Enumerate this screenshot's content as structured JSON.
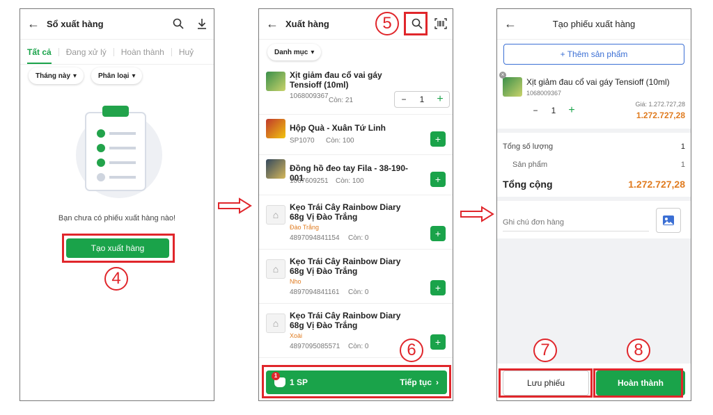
{
  "screen1": {
    "title": "Sổ xuất hàng",
    "tabs": [
      "Tất cả",
      "Đang xử lý",
      "Hoàn thành",
      "Huỷ"
    ],
    "filters": [
      "Tháng này",
      "Phân loại"
    ],
    "empty_text": "Bạn chưa có phiếu xuất hàng nào!",
    "create_button": "Tạo xuất hàng",
    "step": "4"
  },
  "screen2": {
    "title": "Xuất hàng",
    "category_filter": "Danh mục",
    "step_search": "5",
    "step_continue": "6",
    "products": [
      {
        "name": "Xịt giảm đau cổ vai gáy Tensioff (10ml)",
        "code": "1068009367",
        "stock": "Còn: 21",
        "qty": "1"
      },
      {
        "name": "Hộp Quà - Xuân Tứ Linh",
        "code": "SP1070",
        "stock": "Còn: 100"
      },
      {
        "name": "Đồng hồ đeo tay Fila - 38-190-001",
        "code": "1067609251",
        "stock": "Còn: 100"
      },
      {
        "name": "Kẹo Trái Cây Rainbow Diary 68g Vị Đào Trắng",
        "variant": "Đào Trắng",
        "code": "4897094841154",
        "stock": "Còn: 0"
      },
      {
        "name": "Kẹo Trái Cây Rainbow Diary 68g Vị Đào Trắng",
        "variant": "Nho",
        "code": "4897094841161",
        "stock": "Còn: 0"
      },
      {
        "name": "Kẹo Trái Cây Rainbow Diary 68g Vị Đào Trắng",
        "variant": "Xoài",
        "code": "4897095085571",
        "stock": "Còn: 0"
      }
    ],
    "cart_badge": "1",
    "cart_count": "1 SP",
    "continue_label": "Tiếp tục"
  },
  "screen3": {
    "title": "Tạo phiếu xuất hàng",
    "add_product": "+ Thêm sản phẩm",
    "product_name": "Xịt giảm đau cổ vai gáy Tensioff (10ml)",
    "product_code": "1068009367",
    "qty": "1",
    "price_label": "Giá: 1.272.727,28",
    "price_total": "1.272.727,28",
    "total_qty_label": "Tổng số lượng",
    "total_qty_value": "1",
    "products_label": "Sản phẩm",
    "products_value": "1",
    "grand_total_label": "Tổng cộng",
    "grand_total_value": "1.272.727,28",
    "note_placeholder": "Ghi chú đơn hàng",
    "save_button": "Lưu phiếu",
    "complete_button": "Hoàn thành",
    "step_save": "7",
    "step_complete": "8"
  },
  "colors": {
    "accent": "#1aa34a",
    "highlight": "#e0262b",
    "price": "#e07b1f"
  },
  "icons": [
    "back-arrow-icon",
    "search-icon",
    "download-icon",
    "barcode-icon",
    "image-icon",
    "cart-icon",
    "clipboard-illustration"
  ]
}
